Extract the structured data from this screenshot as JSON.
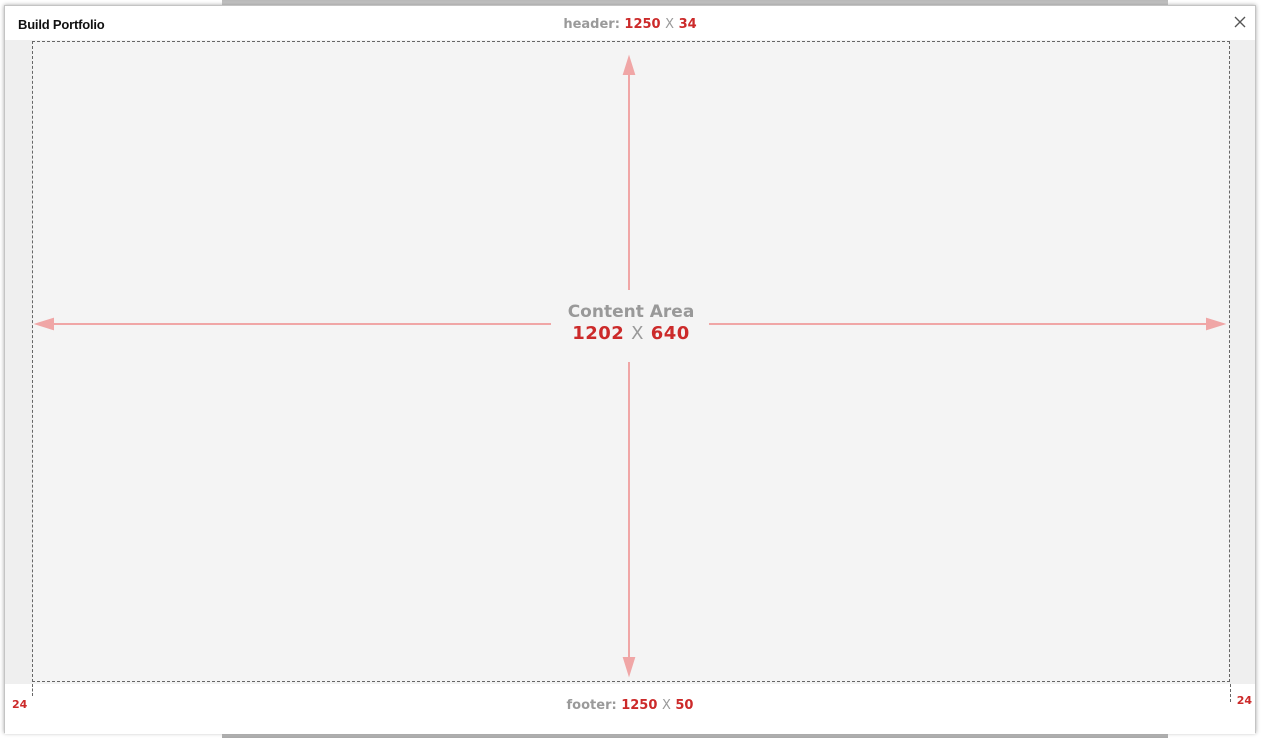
{
  "dialog": {
    "title": "Build Portfolio",
    "close_icon": "close-icon"
  },
  "header_dims": {
    "label": "header:",
    "width": "1250",
    "x": "X",
    "height": "34"
  },
  "content_area": {
    "title": "Content Area",
    "width": "1202",
    "x": "X",
    "height": "640"
  },
  "footer_dims": {
    "label": "footer:",
    "width": "1250",
    "x": "X",
    "height": "50"
  },
  "gutters": {
    "left": "24",
    "right": "24"
  },
  "colors": {
    "accent": "#cc2a2a",
    "arrow": "#f0a0a0",
    "label_gray": "#9a9a9a",
    "content_bg": "#f4f4f4"
  }
}
